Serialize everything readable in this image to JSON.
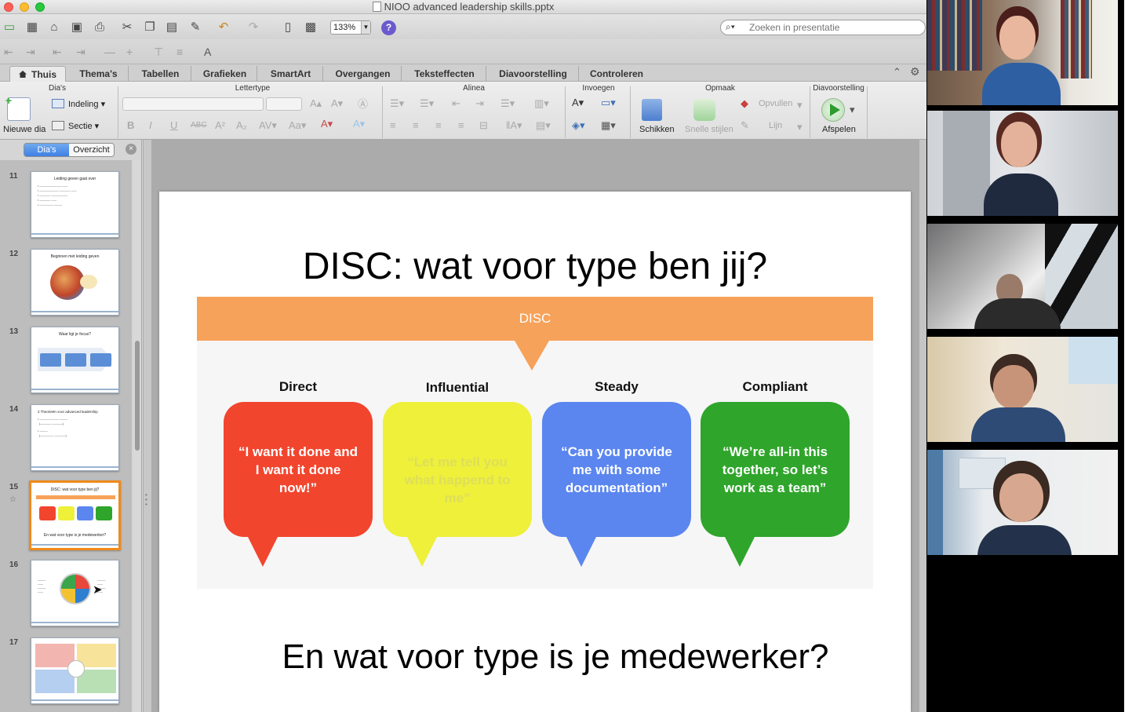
{
  "window": {
    "title": "NIOO advanced leadership skills.pptx"
  },
  "toolbar": {
    "zoom": "133%",
    "help_label": "?",
    "search_placeholder": "Zoeken in presentatie"
  },
  "ribbon_tabs": [
    {
      "label": "Thuis"
    },
    {
      "label": "Thema's"
    },
    {
      "label": "Tabellen"
    },
    {
      "label": "Grafieken"
    },
    {
      "label": "SmartArt"
    },
    {
      "label": "Overgangen"
    },
    {
      "label": "Teksteffecten"
    },
    {
      "label": "Diavoorstelling"
    },
    {
      "label": "Controleren"
    }
  ],
  "ribbon": {
    "groups": {
      "slides": "Dia's",
      "font": "Lettertype",
      "paragraph": "Alinea",
      "insert": "Invoegen",
      "format": "Opmaak",
      "slideshow": "Diavoorstelling"
    },
    "new_slide": "Nieuwe dia",
    "layout": "Indeling",
    "section": "Sectie",
    "arrange": "Schikken",
    "quick_styles": "Snelle stijlen",
    "fill": "Opvullen",
    "line": "Lijn",
    "play": "Afspelen"
  },
  "panel": {
    "tab_slides": "Dia's",
    "tab_outline": "Overzicht",
    "close": "×",
    "slides": [
      {
        "number": "11",
        "title": "Leiding geven gaat over"
      },
      {
        "number": "12",
        "title": "Beginnen met leiding geven"
      },
      {
        "number": "13",
        "title": "Waar ligt je focus?"
      },
      {
        "number": "14",
        "title": "2 Theorieën voor advanced leadership"
      },
      {
        "number": "15",
        "title": "DISC: wat voor type ben jij?",
        "selected": true
      },
      {
        "number": "16",
        "title": ""
      },
      {
        "number": "17",
        "title": ""
      }
    ]
  },
  "slide": {
    "title": "DISC: wat voor type ben jij?",
    "banner": "DISC",
    "categories": [
      {
        "label": "Direct",
        "quote": "“I want it done and I want it done now!”",
        "color": "#f2452e"
      },
      {
        "label": "Influential",
        "quote": "“Let me tell you what happend to me”",
        "color": "#eef03a"
      },
      {
        "label": "Steady",
        "quote": "“Can you provide me with some documentation”",
        "color": "#5b86ef"
      },
      {
        "label": "Compliant",
        "quote": "“We’re all-in this together, so let’s work as a team”",
        "color": "#2fa52b"
      }
    ],
    "subtitle": "En wat voor type is je medewerker?"
  }
}
